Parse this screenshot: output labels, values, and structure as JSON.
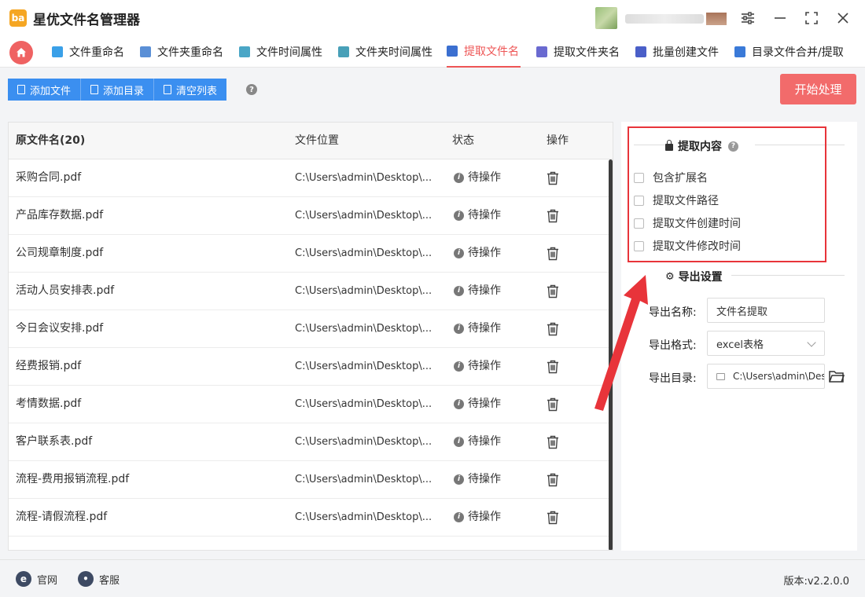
{
  "app": {
    "title": "星优文件名管理器",
    "logo_text": "ba"
  },
  "window_controls": [
    {
      "name": "settings-sliders-icon",
      "glyph": "⚙"
    },
    {
      "name": "minimize-icon",
      "glyph": "—"
    },
    {
      "name": "maximize-icon",
      "glyph": "⛶"
    },
    {
      "name": "close-icon",
      "glyph": "✕"
    }
  ],
  "tabs": [
    {
      "label": "文件重命名",
      "color": "#3aa0e8"
    },
    {
      "label": "文件夹重命名",
      "color": "#5a8fd6"
    },
    {
      "label": "文件时间属性",
      "color": "#4aa6c6"
    },
    {
      "label": "文件夹时间属性",
      "color": "#48a0b8"
    },
    {
      "label": "提取文件名",
      "color": "#3b6fd0",
      "active": true
    },
    {
      "label": "提取文件夹名",
      "color": "#6a6ad0"
    },
    {
      "label": "批量创建文件",
      "color": "#4a5fc8"
    },
    {
      "label": "目录文件合并/提取",
      "color": "#3a7ad8"
    }
  ],
  "toolbar": {
    "add_file": "添加文件",
    "add_dir": "添加目录",
    "clear_list": "清空列表",
    "help": "?",
    "start": "开始处理"
  },
  "table": {
    "headers": {
      "name": "原文件名(20)",
      "location": "文件位置",
      "status": "状态",
      "action": "操作"
    },
    "rows": [
      {
        "name": "采购合同.pdf",
        "location": "C:\\Users\\admin\\Desktop\\...",
        "status": "待操作"
      },
      {
        "name": "产品库存数据.pdf",
        "location": "C:\\Users\\admin\\Desktop\\...",
        "status": "待操作"
      },
      {
        "name": "公司规章制度.pdf",
        "location": "C:\\Users\\admin\\Desktop\\...",
        "status": "待操作"
      },
      {
        "name": "活动人员安排表.pdf",
        "location": "C:\\Users\\admin\\Desktop\\...",
        "status": "待操作"
      },
      {
        "name": "今日会议安排.pdf",
        "location": "C:\\Users\\admin\\Desktop\\...",
        "status": "待操作"
      },
      {
        "name": "经费报销.pdf",
        "location": "C:\\Users\\admin\\Desktop\\...",
        "status": "待操作"
      },
      {
        "name": "考情数据.pdf",
        "location": "C:\\Users\\admin\\Desktop\\...",
        "status": "待操作"
      },
      {
        "name": "客户联系表.pdf",
        "location": "C:\\Users\\admin\\Desktop\\...",
        "status": "待操作"
      },
      {
        "name": "流程-费用报销流程.pdf",
        "location": "C:\\Users\\admin\\Desktop\\...",
        "status": "待操作"
      },
      {
        "name": "流程-请假流程.pdf",
        "location": "C:\\Users\\admin\\Desktop\\...",
        "status": "待操作"
      }
    ]
  },
  "extract": {
    "title": "提取内容",
    "help": "?",
    "options": [
      {
        "label": "包含扩展名",
        "checked": false
      },
      {
        "label": "提取文件路径",
        "checked": false
      },
      {
        "label": "提取文件创建时间",
        "checked": false
      },
      {
        "label": "提取文件修改时间",
        "checked": false
      }
    ]
  },
  "export": {
    "title": "导出设置",
    "name_label": "导出名称:",
    "name_value": "文件名提取",
    "format_label": "导出格式:",
    "format_value": "excel表格",
    "dir_label": "导出目录:",
    "dir_value": "C:\\Users\\admin\\Des"
  },
  "footer": {
    "website": "官网",
    "support": "客服",
    "version": "版本:v2.2.0.0"
  },
  "colors": {
    "accent_red": "#f26b6b",
    "primary_blue": "#3b8ff0",
    "highlight_red": "#e8343a"
  }
}
